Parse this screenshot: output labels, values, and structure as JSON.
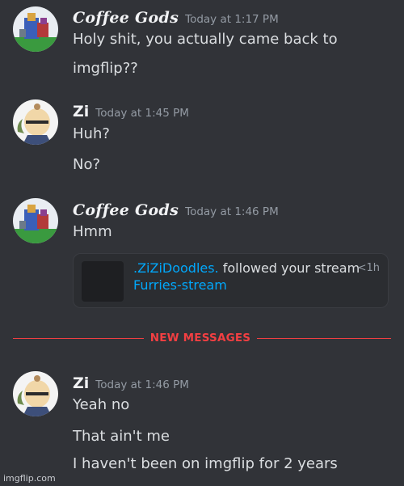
{
  "messages": [
    {
      "author": "Coffee Gods",
      "timestamp": "Today at 1:17 PM",
      "avatar_icon": "pixel-art-avatar-icon",
      "lines": [
        "Holy shit, you actually came back to",
        "imgflip??"
      ]
    },
    {
      "author": "Zi",
      "timestamp": "Today at 1:45 PM",
      "avatar_icon": "anime-character-avatar-icon",
      "lines": [
        "Huh?",
        "No?"
      ]
    },
    {
      "author": "Coffee Gods",
      "timestamp": "Today at 1:46 PM",
      "avatar_icon": "pixel-art-avatar-icon",
      "lines": [
        "Hmm"
      ],
      "embed": {
        "user": ".ZiZiDoodles.",
        "text": " followed your stream",
        "stream": "Furries-stream",
        "time": "<1h"
      }
    },
    {
      "author": "Zi",
      "timestamp": "Today at 1:46 PM",
      "avatar_icon": "anime-character-avatar-icon",
      "lines": [
        "Yeah no",
        "That ain't me",
        "I haven't been on imgflip for 2 years"
      ]
    }
  ],
  "divider": {
    "label": "NEW MESSAGES"
  },
  "watermark": "imgflip.com",
  "colors": {
    "background": "#313338",
    "new_messages_red": "#f23f42",
    "link_blue": "#00a8fc",
    "timestamp_gray": "#949ba4"
  }
}
